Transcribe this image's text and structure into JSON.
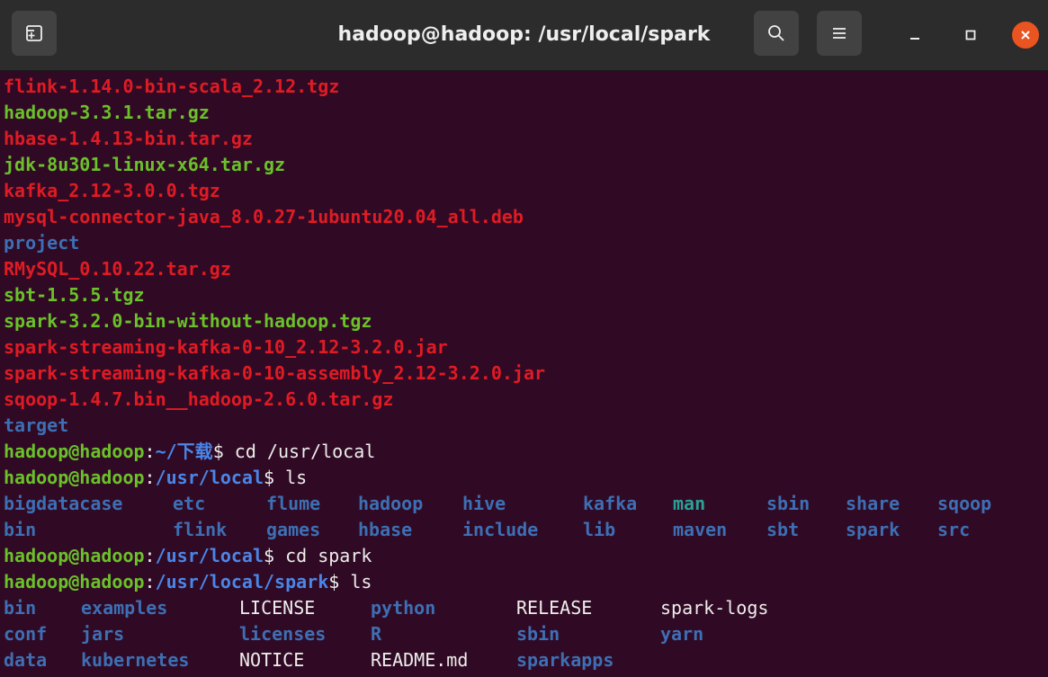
{
  "window": {
    "title": "hadoop@hadoop: /usr/local/spark",
    "icons": {
      "new_tab": "new-tab-icon",
      "search": "search-icon",
      "menu": "hamburger-menu-icon",
      "minimize": "minimize-icon",
      "maximize": "maximize-icon",
      "close": "close-icon"
    }
  },
  "terminal": {
    "downloads_files": [
      {
        "name": "flink-1.14.0-bin-scala_2.12.tgz",
        "color": "red"
      },
      {
        "name": "hadoop-3.3.1.tar.gz",
        "color": "green"
      },
      {
        "name": "hbase-1.4.13-bin.tar.gz",
        "color": "red"
      },
      {
        "name": "jdk-8u301-linux-x64.tar.gz",
        "color": "green"
      },
      {
        "name": "kafka_2.12-3.0.0.tgz",
        "color": "red"
      },
      {
        "name": "mysql-connector-java_8.0.27-1ubuntu20.04_all.deb",
        "color": "red"
      },
      {
        "name": "project",
        "color": "blue"
      },
      {
        "name": "RMySQL_0.10.22.tar.gz",
        "color": "red"
      },
      {
        "name": "sbt-1.5.5.tgz",
        "color": "green"
      },
      {
        "name": "spark-3.2.0-bin-without-hadoop.tgz",
        "color": "green"
      },
      {
        "name": "spark-streaming-kafka-0-10_2.12-3.2.0.jar",
        "color": "red"
      },
      {
        "name": "spark-streaming-kafka-0-10-assembly_2.12-3.2.0.jar",
        "color": "red"
      },
      {
        "name": "sqoop-1.4.7.bin__hadoop-2.6.0.tar.gz",
        "color": "red"
      },
      {
        "name": "target",
        "color": "blue"
      }
    ],
    "commands": [
      {
        "user": "hadoop@hadoop",
        "path": "~/下载",
        "dollar": "$",
        "cmd": " cd /usr/local"
      },
      {
        "user": "hadoop@hadoop",
        "path": "/usr/local",
        "dollar": "$",
        "cmd": " ls"
      },
      {
        "user": "hadoop@hadoop",
        "path": "/usr/local",
        "dollar": "$",
        "cmd": " cd spark"
      },
      {
        "user": "hadoop@hadoop",
        "path": "/usr/local/spark",
        "dollar": "$",
        "cmd": " ls"
      }
    ],
    "usr_local_ls": {
      "row1": [
        "bigdatacase",
        "etc",
        "flume",
        "hadoop",
        "hive",
        "kafka",
        "man",
        "sbin",
        "share",
        "sqoop"
      ],
      "row2": [
        "bin",
        "flink",
        "games",
        "hbase",
        "include",
        "lib",
        "maven",
        "sbt",
        "spark",
        "src"
      ]
    },
    "spark_ls": {
      "row1": [
        "bin",
        "examples",
        "LICENSE",
        "python",
        "RELEASE",
        "spark-logs"
      ],
      "row2": [
        "conf",
        "jars",
        "licenses",
        "R",
        "sbin",
        "yarn"
      ],
      "row3": [
        "data",
        "kubernetes",
        "NOTICE",
        "README.md",
        "sparkapps"
      ]
    }
  }
}
